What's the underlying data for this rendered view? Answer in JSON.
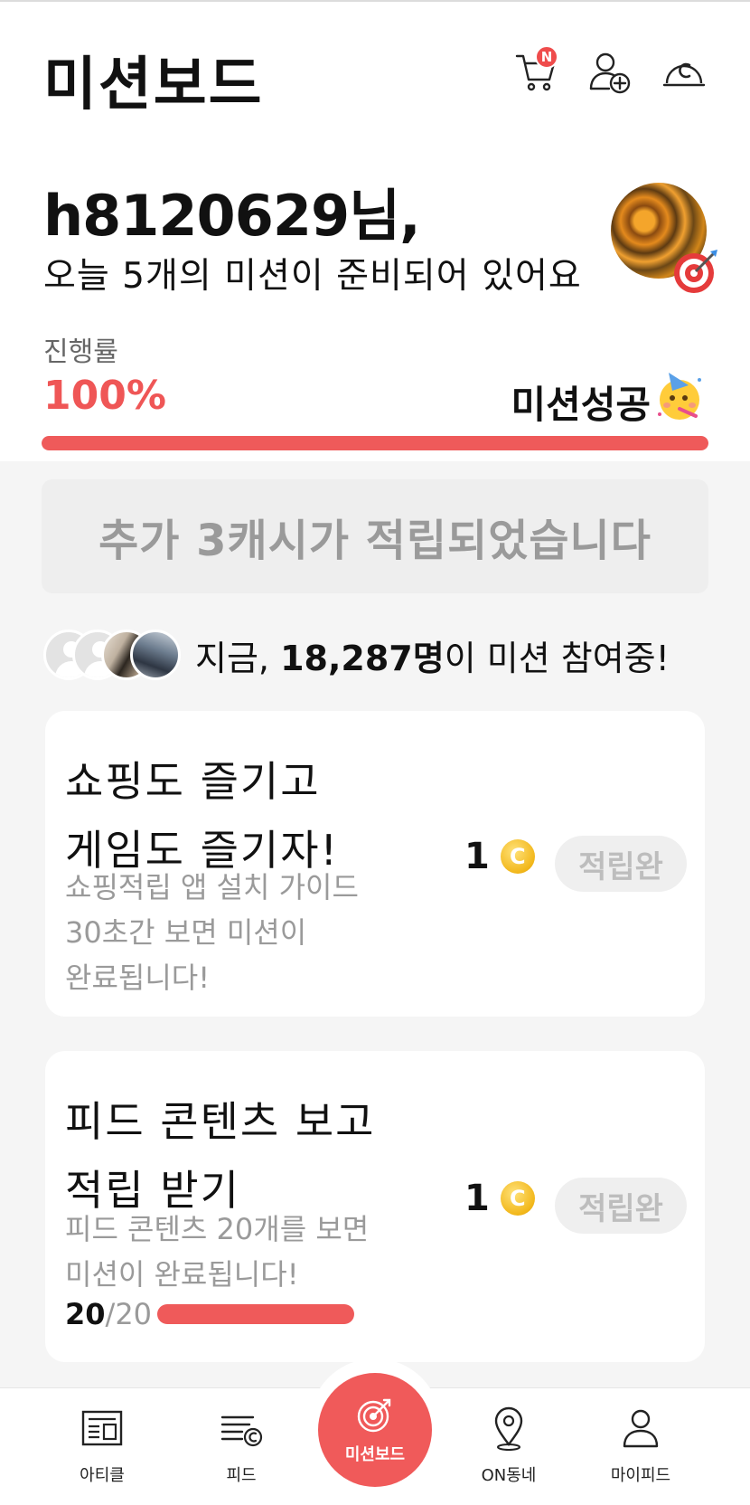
{
  "header": {
    "title": "미션보드",
    "cart_badge": "N",
    "icons": [
      "cart-icon",
      "add-friend-icon",
      "cash-icon"
    ]
  },
  "greeting": {
    "name": "h8120629님,",
    "subtitle": "오늘 5개의 미션이 준비되어 있어요"
  },
  "progress": {
    "label": "진행률",
    "value": "100%",
    "fraction": 1.0,
    "status": "미션성공"
  },
  "bonus_message": "추가 3캐시가 적립되었습니다",
  "participants": {
    "prefix": "지금,",
    "count": "18,287명",
    "suffix": "이 미션 참여중!"
  },
  "missions": [
    {
      "title_line1": "쇼핑도 즐기고",
      "title_line2": "게임도 즐기자!",
      "desc_line1": "쇼핑적립 앱 설치 가이드",
      "desc_line2": "30초간 보면 미션이",
      "desc_line3": "완료됩니다!",
      "reward": "1",
      "coin_symbol": "C",
      "status": "적립완"
    },
    {
      "title_line1": "피드 콘텐츠 보고",
      "title_line2": "적립 받기",
      "desc_line1": "피드 콘텐츠 20개를 보면",
      "desc_line2": "미션이 완료됩니다!",
      "reward": "1",
      "coin_symbol": "C",
      "status": "적립완",
      "progress_current": "20",
      "progress_total": "/20",
      "progress_fraction": 1.0
    }
  ],
  "bottom_nav": {
    "items": [
      {
        "label": "아티클",
        "icon": "article-icon"
      },
      {
        "label": "피드",
        "icon": "feed-icon"
      },
      {
        "label": "미션보드",
        "icon": "target-icon"
      },
      {
        "label": "ON동네",
        "icon": "location-icon"
      },
      {
        "label": "마이피드",
        "icon": "profile-icon"
      }
    ]
  },
  "colors": {
    "accent": "#ef5a5a",
    "muted_text": "#9a9a9a",
    "background": "#f5f5f5"
  }
}
